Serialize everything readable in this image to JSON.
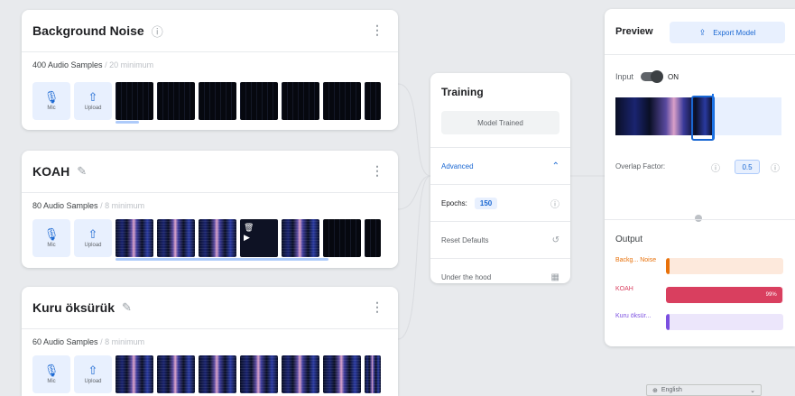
{
  "classes": [
    {
      "name": "Background Noise",
      "samples_text": "400 Audio Samples",
      "min_text": "/ 20 minimum",
      "mic_label": "Mic",
      "upload_label": "Upload"
    },
    {
      "name": "KOAH",
      "samples_text": "80 Audio Samples",
      "min_text": "/ 8 minimum",
      "mic_label": "Mic",
      "upload_label": "Upload"
    },
    {
      "name": "Kuru öksürük",
      "samples_text": "60 Audio Samples",
      "min_text": "/ 8 minimum",
      "mic_label": "Mic",
      "upload_label": "Upload"
    }
  ],
  "training": {
    "title": "Training",
    "trained_button": "Model Trained",
    "advanced_label": "Advanced",
    "epochs_label": "Epochs:",
    "epochs_value": "150",
    "reset_label": "Reset Defaults",
    "under_hood_label": "Under the hood"
  },
  "preview": {
    "title": "Preview",
    "export_label": "Export Model",
    "input_label": "Input",
    "on_label": "ON",
    "overlap_label": "Overlap Factor:",
    "overlap_value": "0.5",
    "output_title": "Output",
    "outputs": [
      {
        "label": "Backg... Noise",
        "value": 0.01,
        "percent_text": "",
        "color": "#e8710a",
        "track": "#fde9dc"
      },
      {
        "label": "KOAH",
        "value": 0.99,
        "percent_text": "99%",
        "color": "#d93f5f",
        "track": "#fbe2e8"
      },
      {
        "label": "Kuru öksür...",
        "value": 0.02,
        "percent_text": "",
        "color": "#7b4fe0",
        "track": "#ece6fb"
      }
    ]
  },
  "footer": {
    "language": "English"
  },
  "colors": {
    "accent": "#1967d2",
    "background": "#e8eaed"
  }
}
